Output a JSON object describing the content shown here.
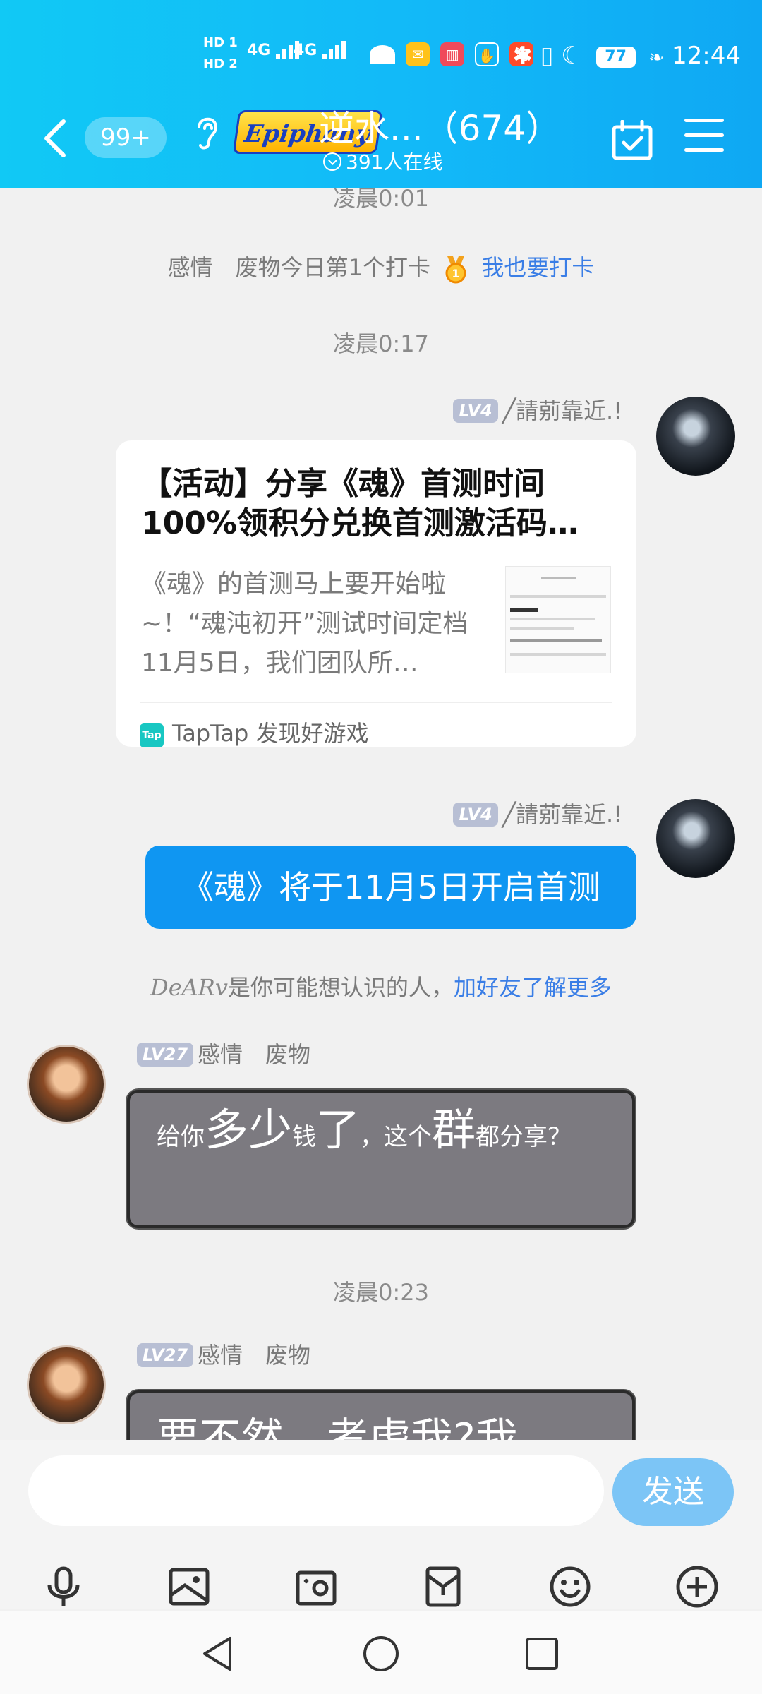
{
  "status_bar": {
    "hd1": "HD 1",
    "hd2": "HD 2",
    "net1": "4G",
    "net2": "4G",
    "battery": "77",
    "time": "12:44"
  },
  "header": {
    "unread_badge": "99+",
    "logo_text": "Epiphany",
    "title": "逆水...（674）",
    "online": "391人在线"
  },
  "chat": {
    "time_top_partial": "凌晨0:01",
    "checkin": {
      "text": "感情　废物今日第1个打卡",
      "link": "我也要打卡"
    },
    "time_1": "凌晨0:17",
    "msg1": {
      "level": "LV4",
      "nickname": "╱請莂靠近.!",
      "card_title": "【活动】分享《魂》首测时间100%领积分兑换首测激活码…",
      "card_desc": "《魂》的首测马上要开始啦~！“魂沌初开”测试时间定档11月5日，我们团队所…",
      "card_source_icon": "Tap",
      "card_source": "TapTap 发现好游戏"
    },
    "msg2": {
      "level": "LV4",
      "nickname": "╱請莂靠近.!",
      "text": "《魂》将于11月5日开启首测"
    },
    "suggest": {
      "name": "DeARv",
      "text": "是你可能想认识的人，",
      "link": "加好友了解更多"
    },
    "msg3": {
      "level": "LV27",
      "nickname": "感情　废物",
      "parts": [
        "给你",
        "多少",
        "钱",
        "了",
        "，",
        "这个",
        "群",
        "都分享？"
      ]
    },
    "time_2": "凌晨0:23",
    "msg4": {
      "level": "LV27",
      "nickname": "感情　废物",
      "text": "要不然…考虑我?我"
    }
  },
  "input": {
    "placeholder": "",
    "send_label": "发送"
  }
}
